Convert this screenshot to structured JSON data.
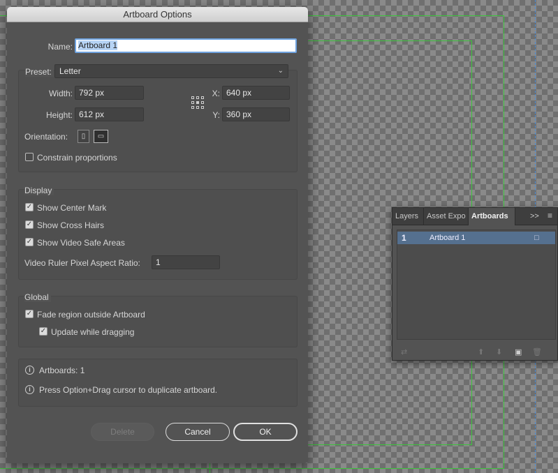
{
  "dialog": {
    "title": "Artboard Options",
    "name_label": "Name:",
    "name_value": "Artboard 1",
    "preset_label": "Preset:",
    "preset_value": "Letter",
    "width_label": "Width:",
    "width_value": "792 px",
    "height_label": "Height:",
    "height_value": "612 px",
    "x_label": "X:",
    "x_value": "640 px",
    "y_label": "Y:",
    "y_value": "360 px",
    "orientation_label": "Orientation:",
    "constrain_label": "Constrain proportions",
    "display_heading": "Display",
    "show_center_mark": "Show Center Mark",
    "show_cross_hairs": "Show Cross Hairs",
    "show_video_safe": "Show Video Safe Areas",
    "video_ratio_label": "Video Ruler Pixel Aspect Ratio:",
    "video_ratio_value": "1",
    "global_heading": "Global",
    "fade_region": "Fade region outside Artboard",
    "update_dragging": "Update while dragging",
    "info_artboards": "Artboards: 1",
    "info_tip": "Press Option+Drag cursor to duplicate artboard.",
    "delete_label": "Delete",
    "cancel_label": "Cancel",
    "ok_label": "OK",
    "checks": {
      "constrain": false,
      "center_mark": true,
      "cross_hairs": true,
      "video_safe": true,
      "fade_region": true,
      "update_dragging": true
    }
  },
  "panel": {
    "tabs": [
      "Layers",
      "Asset Expo",
      "Artboards"
    ],
    "active_tab": "Artboards",
    "more_label": ">>",
    "rows": [
      {
        "index": "1",
        "name": "Artboard 1"
      }
    ]
  },
  "colors": {
    "guide_green": "#3cc43c",
    "guide_blue": "#4a8cd6",
    "selection_blue": "#55708f"
  }
}
